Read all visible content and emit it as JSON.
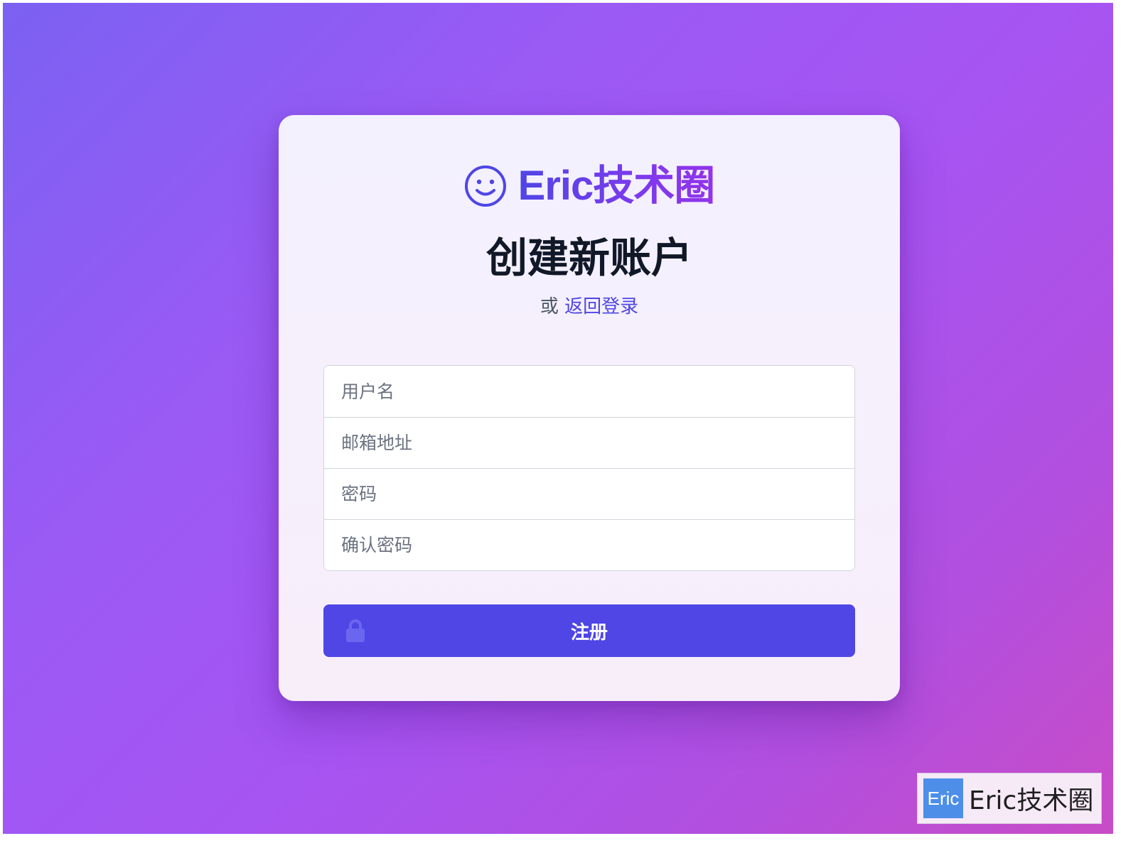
{
  "brand": {
    "name": "Eric技术圈",
    "icon": "smiley-face-icon",
    "gradient_start": "#4f46e5",
    "gradient_end": "#9333ea"
  },
  "page": {
    "title": "创建新账户",
    "or_text": "或",
    "back_to_login": "返回登录"
  },
  "form": {
    "username_placeholder": "用户名",
    "email_placeholder": "邮箱地址",
    "password_placeholder": "密码",
    "confirm_password_placeholder": "确认密码",
    "submit_label": "注册",
    "submit_icon": "lock-icon",
    "submit_color": "#4f46e5"
  },
  "watermark": {
    "badge": "Eric",
    "text": "Eric技术圈"
  }
}
